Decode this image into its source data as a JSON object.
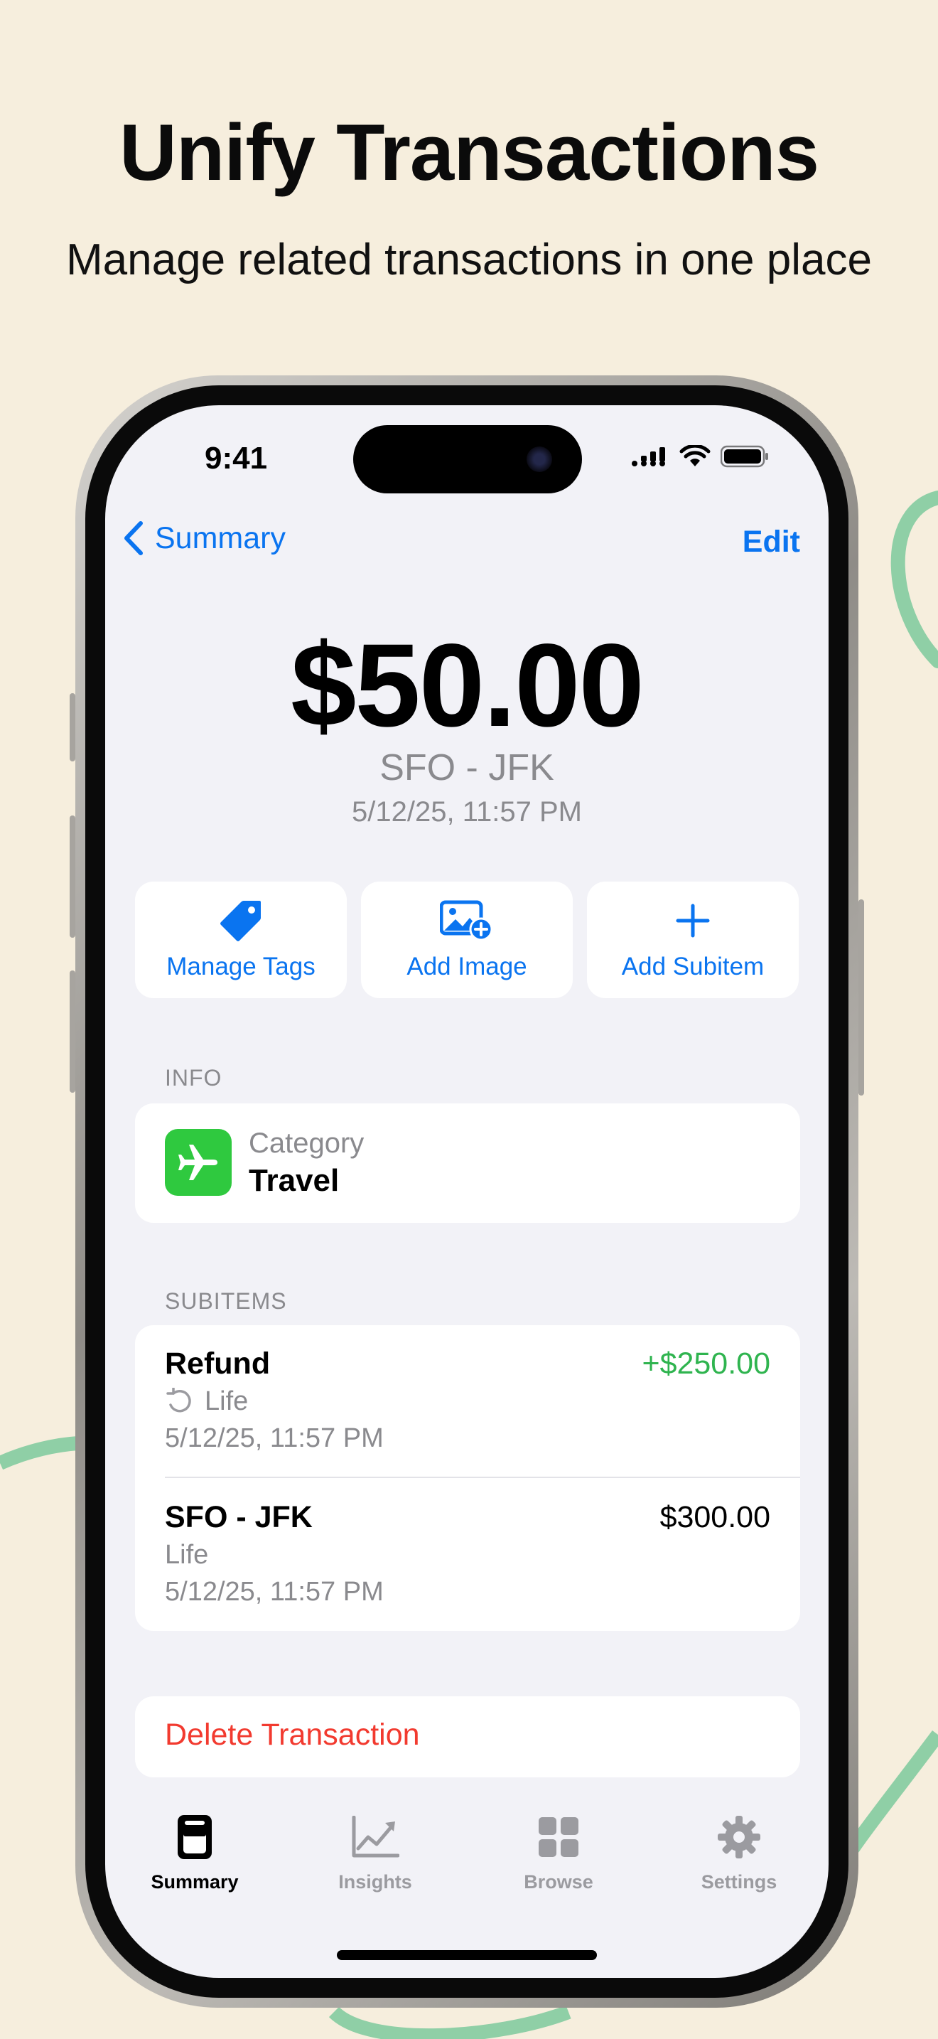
{
  "headline": "Unify Transactions",
  "subheadline": "Manage related transactions in one place",
  "status_bar": {
    "time": "9:41"
  },
  "nav": {
    "back_label": "Summary",
    "edit_label": "Edit"
  },
  "transaction": {
    "amount": "$50.00",
    "title": "SFO - JFK",
    "datetime": "5/12/25, 11:57 PM"
  },
  "actions": [
    {
      "label": "Manage Tags",
      "icon": "tag-icon"
    },
    {
      "label": "Add Image",
      "icon": "add-image-icon"
    },
    {
      "label": "Add Subitem",
      "icon": "plus-icon"
    }
  ],
  "info": {
    "header": "INFO",
    "category_caption": "Category",
    "category_value": "Travel",
    "category_icon": "airplane-icon",
    "category_color": "#2FC93F"
  },
  "subitems": {
    "header": "SUBITEMS",
    "items": [
      {
        "name": "Refund",
        "amount": "+$250.00",
        "amount_color": "#2FB44F",
        "category": "Life",
        "recurring": true,
        "datetime": "5/12/25, 11:57 PM"
      },
      {
        "name": "SFO - JFK",
        "amount": "$300.00",
        "amount_color": "#000000",
        "category": "Life",
        "recurring": false,
        "datetime": "5/12/25, 11:57 PM"
      }
    ]
  },
  "delete_label": "Delete Transaction",
  "tabs": [
    {
      "label": "Summary",
      "icon": "summary-icon",
      "active": true
    },
    {
      "label": "Insights",
      "icon": "chart-icon",
      "active": false
    },
    {
      "label": "Browse",
      "icon": "grid-icon",
      "active": false
    },
    {
      "label": "Settings",
      "icon": "gear-icon",
      "active": false
    }
  ],
  "colors": {
    "accent": "#0A74F0",
    "destructive": "#F23A2F",
    "background": "#F6EEDD"
  }
}
